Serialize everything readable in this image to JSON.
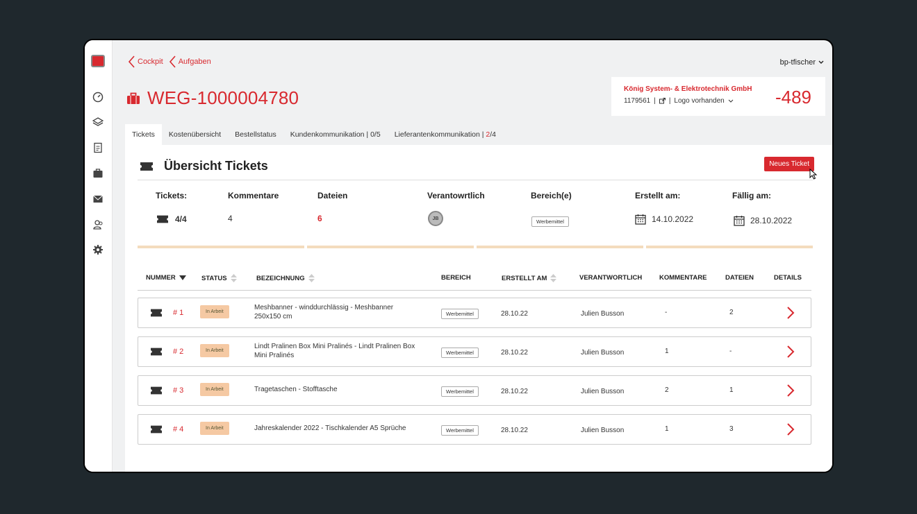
{
  "breadcrumbs": [
    {
      "label": "Cockpit"
    },
    {
      "label": "Aufgaben"
    }
  ],
  "user": {
    "name": "bp-tfischer"
  },
  "page": {
    "title": "WEG-1000004780"
  },
  "customer": {
    "name": "König System- & Elektrotechnik GmbH",
    "id": "1179561",
    "logo_text": "Logo vorhanden",
    "number": "-489"
  },
  "tabs": [
    {
      "label": "Tickets",
      "active": true
    },
    {
      "label": "Kostenübersicht"
    },
    {
      "label": "Bestellstatus"
    },
    {
      "label": "Kundenkommunikation | 0/5"
    },
    {
      "label_prefix": "Lieferantenkommunikation | ",
      "label_hl": "2",
      "label_suffix": "/4"
    }
  ],
  "panel": {
    "heading": "Übersicht Tickets",
    "new_ticket_label": "Neues Ticket"
  },
  "summary": {
    "labels": {
      "tickets": "Tickets:",
      "kommentare": "Kommentare",
      "dateien": "Dateien",
      "verantwortlich": "Verantowrtlich",
      "bereich": "Bereich(e)",
      "erstellt": "Erstellt am:",
      "faellig": "Fällig am:"
    },
    "values": {
      "tickets": "4/4",
      "kommentare": "4",
      "dateien": "6",
      "verantwortlich": "JB",
      "bereich": "Werbemittel",
      "erstellt": "14.10.2022",
      "faellig": "28.10.2022"
    }
  },
  "table": {
    "headers": {
      "nummer": "NUMMER",
      "status": "STATUS",
      "bezeichnung": "BEZEICHNUNG",
      "bereich": "BEREICH",
      "erstellt": "ERSTELLT AM",
      "verantwortlich": "VERANTWORTLICH",
      "kommentare": "KOMMENTARE",
      "dateien": "DATEIEN",
      "details": "DETAILS"
    },
    "rows": [
      {
        "num": "# 1",
        "status": "In Arbeit",
        "name1": "Meshbanner - winddurchlässig - Meshbanner",
        "name2": "250x150 cm",
        "bereich": "Werbemittel",
        "erstellt": "28.10.22",
        "verantwortlich": "Julien Busson",
        "kommentare": "-",
        "dateien": "2"
      },
      {
        "num": "# 2",
        "status": "In Arbeit",
        "name1": "Lindt Pralinen Box Mini Pralinés - Lindt Pralinen Box",
        "name2": "Mini Pralinés",
        "bereich": "Werbemittel",
        "erstellt": "28.10.22",
        "verantwortlich": "Julien Busson",
        "kommentare": "1",
        "dateien": "-"
      },
      {
        "num": "# 3",
        "status": "In Arbeit",
        "name1": "Tragetaschen - Stofftasche",
        "name2": "",
        "bereich": "Werbemittel",
        "erstellt": "28.10.22",
        "verantwortlich": "Julien Busson",
        "kommentare": "2",
        "dateien": "1"
      },
      {
        "num": "# 4",
        "status": "In Arbeit",
        "name1": "Jahreskalender 2022 - Tischkalender A5 Sprüche",
        "name2": "",
        "bereich": "Werbemittel",
        "erstellt": "28.10.22",
        "verantwortlich": "Julien Busson",
        "kommentare": "1",
        "dateien": "3"
      }
    ]
  },
  "colors": {
    "accent": "#d8292f",
    "status_bg": "#f5c9a3",
    "progress": "#f4dcbd"
  }
}
